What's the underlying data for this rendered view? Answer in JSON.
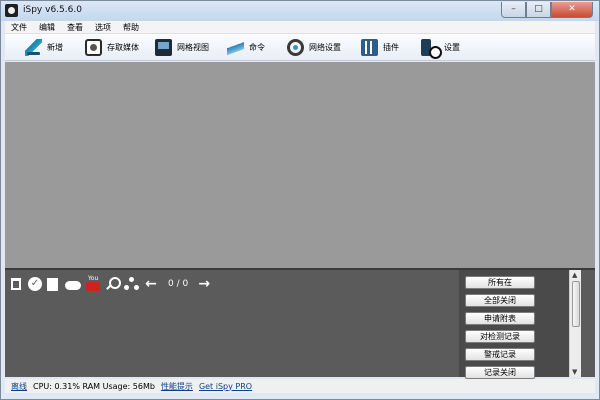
{
  "window": {
    "title": "iSpy v6.5.6.0"
  },
  "window_controls": {
    "minimize": "–",
    "maximize": "□",
    "close": "✕"
  },
  "menu": {
    "items": [
      "文件",
      "编辑",
      "查看",
      "选项",
      "帮助"
    ]
  },
  "toolbar": {
    "items": [
      {
        "label": "新增",
        "icon": "add-camera-icon"
      },
      {
        "label": "存取媒体",
        "icon": "media-icon"
      },
      {
        "label": "网格视图",
        "icon": "grid-view-icon"
      },
      {
        "label": "命令",
        "icon": "command-icon"
      },
      {
        "label": "网络设置",
        "icon": "network-settings-icon"
      },
      {
        "label": "插件",
        "icon": "plugin-icon"
      },
      {
        "label": "设置",
        "icon": "settings-icon"
      }
    ]
  },
  "bottom_toolbar": {
    "youtube_text": "You",
    "prev_arrow": "←",
    "next_arrow": "→",
    "counter": "0 / 0"
  },
  "actions": [
    "所有在",
    "全部关闭",
    "申请附表",
    "对检测记录",
    "警戒记录",
    "记录关闭"
  ],
  "scrollbar": {
    "up": "▲",
    "down": "▼"
  },
  "status": {
    "offline": "离线",
    "resources": "CPU: 0.31% RAM Usage: 56Mb",
    "perf_tips": "性能提示",
    "pro_link": "Get iSpy PRO"
  },
  "colors": {
    "main_view_bg": "#9a9a9a",
    "bottom_panel_bg": "#5b5b5b",
    "link": "#0b3f8f"
  }
}
